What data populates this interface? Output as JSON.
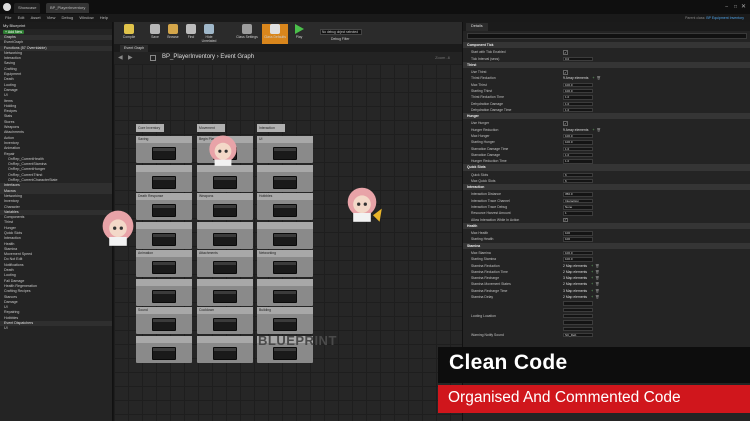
{
  "titlebar": {
    "tabs": [
      "Showcase",
      "BP_PlayerInventory"
    ]
  },
  "menu": [
    "File",
    "Edit",
    "Asset",
    "View",
    "Debug",
    "Window",
    "Help"
  ],
  "parent_class": {
    "label": "Parent class:",
    "value": "BP Equipment Inventory"
  },
  "left_panel": {
    "header": "My Blueprint",
    "add_new": "+ Add New",
    "rows": [
      {
        "t": "Graphs",
        "s": 1
      },
      {
        "t": "EventGraph",
        "s": 0
      },
      {
        "t": "Functions (57 Overridable)",
        "s": 1
      },
      {
        "t": "Networking",
        "s": 0
      },
      {
        "t": "Interaction",
        "s": 0
      },
      {
        "t": "Saving",
        "s": 0
      },
      {
        "t": "Crafting",
        "s": 0
      },
      {
        "t": "Equipment",
        "s": 0
      },
      {
        "t": "Death",
        "s": 0
      },
      {
        "t": "Looting",
        "s": 0
      },
      {
        "t": "Damage",
        "s": 0
      },
      {
        "t": "UI",
        "s": 0
      },
      {
        "t": "Items",
        "s": 0
      },
      {
        "t": "Holding",
        "s": 0
      },
      {
        "t": "Recipes",
        "s": 0
      },
      {
        "t": "Stats",
        "s": 0
      },
      {
        "t": "Stores",
        "s": 0
      },
      {
        "t": "Weapons",
        "s": 0
      },
      {
        "t": "Attachments",
        "s": 0
      },
      {
        "t": "Action",
        "s": 0
      },
      {
        "t": "Inventory",
        "s": 0
      },
      {
        "t": "Animation",
        "s": 0
      },
      {
        "t": "Repair",
        "s": 0
      },
      {
        "t": "OnRep_CurrentHealth",
        "s": 2
      },
      {
        "t": "OnRep_CurrentStamina",
        "s": 2
      },
      {
        "t": "OnRep_CurrentHunger",
        "s": 2
      },
      {
        "t": "OnRep_CurrentThirst",
        "s": 2
      },
      {
        "t": "OnRep_CurrentCharacterState",
        "s": 2
      },
      {
        "t": "Interfaces",
        "s": 1
      },
      {
        "t": "Macros",
        "s": 1
      },
      {
        "t": "Networking",
        "s": 0
      },
      {
        "t": "Inventory",
        "s": 0
      },
      {
        "t": "Character",
        "s": 0
      },
      {
        "t": "Variables",
        "s": 1
      },
      {
        "t": "Components",
        "s": 0
      },
      {
        "t": "Thirst",
        "s": 0
      },
      {
        "t": "Hunger",
        "s": 0
      },
      {
        "t": "Quick Slots",
        "s": 0
      },
      {
        "t": "Interaction",
        "s": 0
      },
      {
        "t": "Health",
        "s": 0
      },
      {
        "t": "Stamina",
        "s": 0
      },
      {
        "t": "Movement Speed",
        "s": 0
      },
      {
        "t": "Do Not Edit",
        "s": 0
      },
      {
        "t": "Notifications",
        "s": 0
      },
      {
        "t": "Death",
        "s": 0
      },
      {
        "t": "Looting",
        "s": 0
      },
      {
        "t": "Fall Damage",
        "s": 0
      },
      {
        "t": "Health Regeneration",
        "s": 0
      },
      {
        "t": "Crafting Recipes",
        "s": 0
      },
      {
        "t": "Stances",
        "s": 0
      },
      {
        "t": "Damage",
        "s": 0
      },
      {
        "t": "UI",
        "s": 0
      },
      {
        "t": "Repairing",
        "s": 0
      },
      {
        "t": "Hotbbles",
        "s": 0
      },
      {
        "t": "Event Dispatchers",
        "s": 1
      },
      {
        "t": "UI",
        "s": 0
      }
    ]
  },
  "toolbar": {
    "title": "Toolbar",
    "buttons": [
      "Compile",
      "Save",
      "Browse",
      "Find",
      "Hide Unrelated",
      "Class Settings",
      "Class Defaults",
      "Play"
    ],
    "debug_select": "No debug object selected",
    "debug_filter": "Debug Filter"
  },
  "graph": {
    "tab": "Event Graph",
    "breadcrumb": "BP_PlayerInventory  ›  Event Graph",
    "zoom": "Zoom -6",
    "watermark": "BLUEPRINT",
    "top_labels": [
      "Core Inventory",
      "Movement",
      "Interaction"
    ],
    "comments": [
      [
        "Saving",
        "Begin Play",
        "UI"
      ],
      [
        "",
        "",
        ""
      ],
      [
        "Death Response",
        "Weapons",
        "Hotbbles"
      ],
      [
        "",
        "",
        ""
      ],
      [
        "Animation",
        "Attachments",
        "Networking"
      ],
      [
        "",
        "",
        ""
      ],
      [
        "Sound",
        "Cooldown",
        "Building"
      ],
      [
        "",
        "",
        ""
      ]
    ]
  },
  "details": {
    "tab": "Details",
    "rows": [
      {
        "type": "sec",
        "k": "Component Tick"
      },
      {
        "type": "cb",
        "k": "Start with Tick Enabled",
        "on": true
      },
      {
        "type": "val",
        "k": "Tick Interval (secs)",
        "v": "0.0"
      },
      {
        "type": "sec",
        "k": "Thirst"
      },
      {
        "type": "cb",
        "k": "Use Thirst",
        "on": true
      },
      {
        "type": "arr",
        "k": "Thirst Reduction",
        "v": "9 Array elements"
      },
      {
        "type": "val",
        "k": "Max Thirst",
        "v": "100.0"
      },
      {
        "type": "val",
        "k": "Starting Thirst",
        "v": "100.0"
      },
      {
        "type": "val",
        "k": "Thirst Reduction Time",
        "v": "1.0"
      },
      {
        "type": "val",
        "k": "Dehydration Damage",
        "v": "1.0"
      },
      {
        "type": "val",
        "k": "Dehydration Damage Time",
        "v": "1.0"
      },
      {
        "type": "sec",
        "k": "Hunger"
      },
      {
        "type": "cb",
        "k": "Use Hunger",
        "on": true
      },
      {
        "type": "arr",
        "k": "Hunger Reduction",
        "v": "9 Array elements"
      },
      {
        "type": "val",
        "k": "Max Hunger",
        "v": "100.0"
      },
      {
        "type": "val",
        "k": "Starting Hunger",
        "v": "100.0"
      },
      {
        "type": "val",
        "k": "Starvation Damage Time",
        "v": "1.0"
      },
      {
        "type": "val",
        "k": "Starvation Damage",
        "v": "1.0"
      },
      {
        "type": "val",
        "k": "Hunger Reduction Time",
        "v": "1.0"
      },
      {
        "type": "sec",
        "k": "Quick Slots"
      },
      {
        "type": "val",
        "k": "Quick Slots",
        "v": "6"
      },
      {
        "type": "val",
        "k": "Max Quick Slots",
        "v": "6"
      },
      {
        "type": "sec",
        "k": "Interaction"
      },
      {
        "type": "val",
        "k": "Interaction Distance",
        "v": "350.0"
      },
      {
        "type": "val",
        "k": "Interaction Trace Channel",
        "v": "Interaction"
      },
      {
        "type": "val",
        "k": "Interaction Trace Debug",
        "v": "None"
      },
      {
        "type": "val",
        "k": "Resource Harvest Amount",
        "v": "1"
      },
      {
        "type": "cb",
        "k": "Allow Interaction While In Action",
        "on": true
      },
      {
        "type": "sec",
        "k": "Health"
      },
      {
        "type": "val",
        "k": "Max Health",
        "v": "100"
      },
      {
        "type": "val",
        "k": "Starting Health",
        "v": "100"
      },
      {
        "type": "sec",
        "k": "Stamina"
      },
      {
        "type": "val",
        "k": "Max Stamina",
        "v": "100.0"
      },
      {
        "type": "val",
        "k": "Starting Stamina",
        "v": "100.0"
      },
      {
        "type": "arr",
        "k": "Stamina Reduction",
        "v": "2 Map elements"
      },
      {
        "type": "arr",
        "k": "Stamina Reduction Time",
        "v": "2 Map elements"
      },
      {
        "type": "arr",
        "k": "Stamina Recharge",
        "v": "3 Map elements"
      },
      {
        "type": "arr",
        "k": "Stamina Movement States",
        "v": "2 Map elements"
      },
      {
        "type": "arr",
        "k": "Stamina Recharge Time",
        "v": "3 Map elements"
      },
      {
        "type": "arr",
        "k": "Stamina Delay",
        "v": "2 Map elements"
      },
      {
        "type": "val",
        "k": "",
        "v": ""
      },
      {
        "type": "val",
        "k": "",
        "v": ""
      },
      {
        "type": "val",
        "k": "Looting Location",
        "v": ""
      },
      {
        "type": "val",
        "k": "",
        "v": ""
      },
      {
        "type": "val",
        "k": "",
        "v": ""
      },
      {
        "type": "val",
        "k": "Warning Notify Sound",
        "v": "SC_Deb"
      }
    ]
  },
  "overlay": {
    "title": "Clean Code",
    "subtitle": "Organised And Commented Code"
  },
  "colors": {
    "accent_orange": "#d9861c",
    "overlay_red": "#d0161c",
    "add_green": "#2e7d32"
  }
}
